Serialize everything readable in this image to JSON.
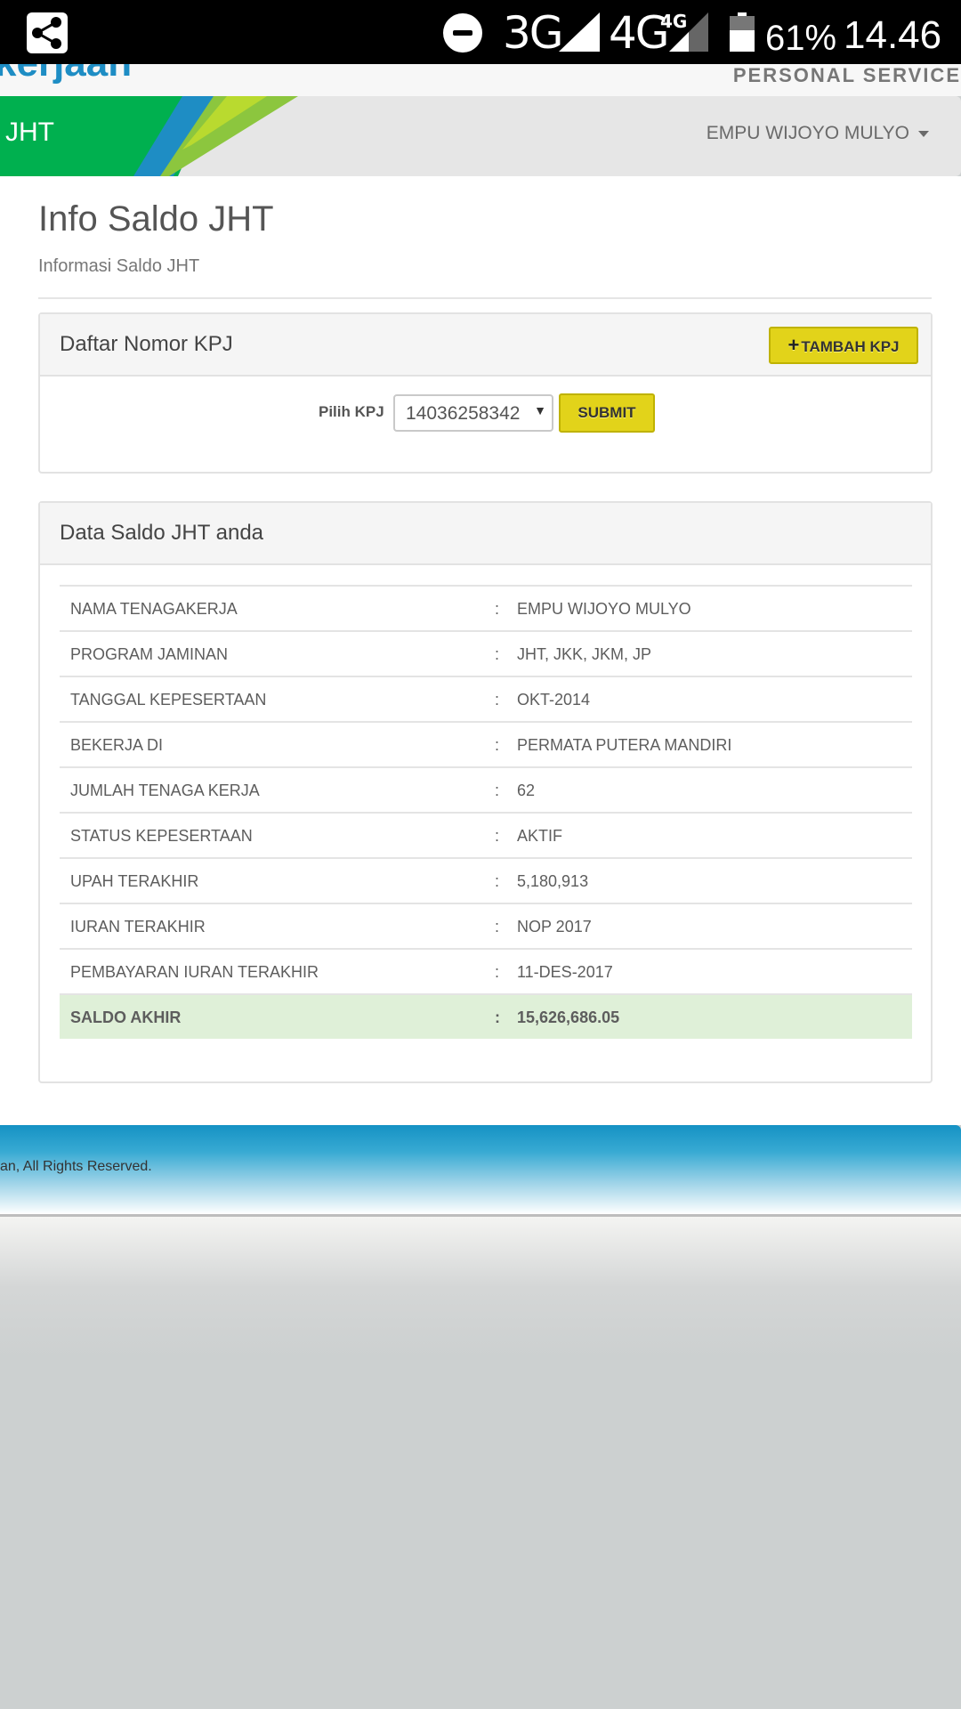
{
  "status_bar": {
    "network_3g": "3G",
    "network_4g": "4G",
    "network_4g_sup": "4G",
    "battery_percent": "61%",
    "battery_level": 0.61,
    "time": "14.46",
    "icons": [
      "share-icon",
      "do-not-disturb-icon",
      "signal-icon",
      "battery-icon"
    ]
  },
  "header": {
    "brand_partial": "kerjaan",
    "tagline": "PERSONAL SERVICE",
    "nav_title": "JHT",
    "user_name": "EMPU WIJOYO MULYO",
    "colors": {
      "green": "#00b04f",
      "lime": "#8cc63e",
      "blue": "#1e8dc4"
    }
  },
  "page": {
    "title": "Info Saldo JHT",
    "subtitle": "Informasi Saldo JHT"
  },
  "kpj_panel": {
    "title": "Daftar Nomor KPJ",
    "add_button": "TAMBAH KPJ",
    "select_label": "Pilih KPJ",
    "selected_kpj": "14036258342",
    "submit_button": "SUBMIT"
  },
  "saldo_panel": {
    "title": "Data Saldo JHT anda",
    "separator": ":",
    "rows": [
      {
        "label": "NAMA TENAGAKERJA",
        "value": "EMPU WIJOYO MULYO"
      },
      {
        "label": "PROGRAM JAMINAN",
        "value": "JHT, JKK, JKM, JP"
      },
      {
        "label": "TANGGAL KEPESERTAAN",
        "value": "OKT-2014"
      },
      {
        "label": "BEKERJA DI",
        "value": "PERMATA PUTERA MANDIRI"
      },
      {
        "label": "JUMLAH TENAGA KERJA",
        "value": "62"
      },
      {
        "label": "STATUS KEPESERTAAN",
        "value": "AKTIF"
      },
      {
        "label": "UPAH TERAKHIR",
        "value": "5,180,913"
      },
      {
        "label": "IURAN TERAKHIR",
        "value": "NOP 2017"
      },
      {
        "label": "PEMBAYARAN IURAN TERAKHIR",
        "value": "11-DES-2017"
      },
      {
        "label": "SALDO AKHIR",
        "value": "15,626,686.05"
      }
    ]
  },
  "footer": {
    "text": "an, All Rights Reserved."
  }
}
